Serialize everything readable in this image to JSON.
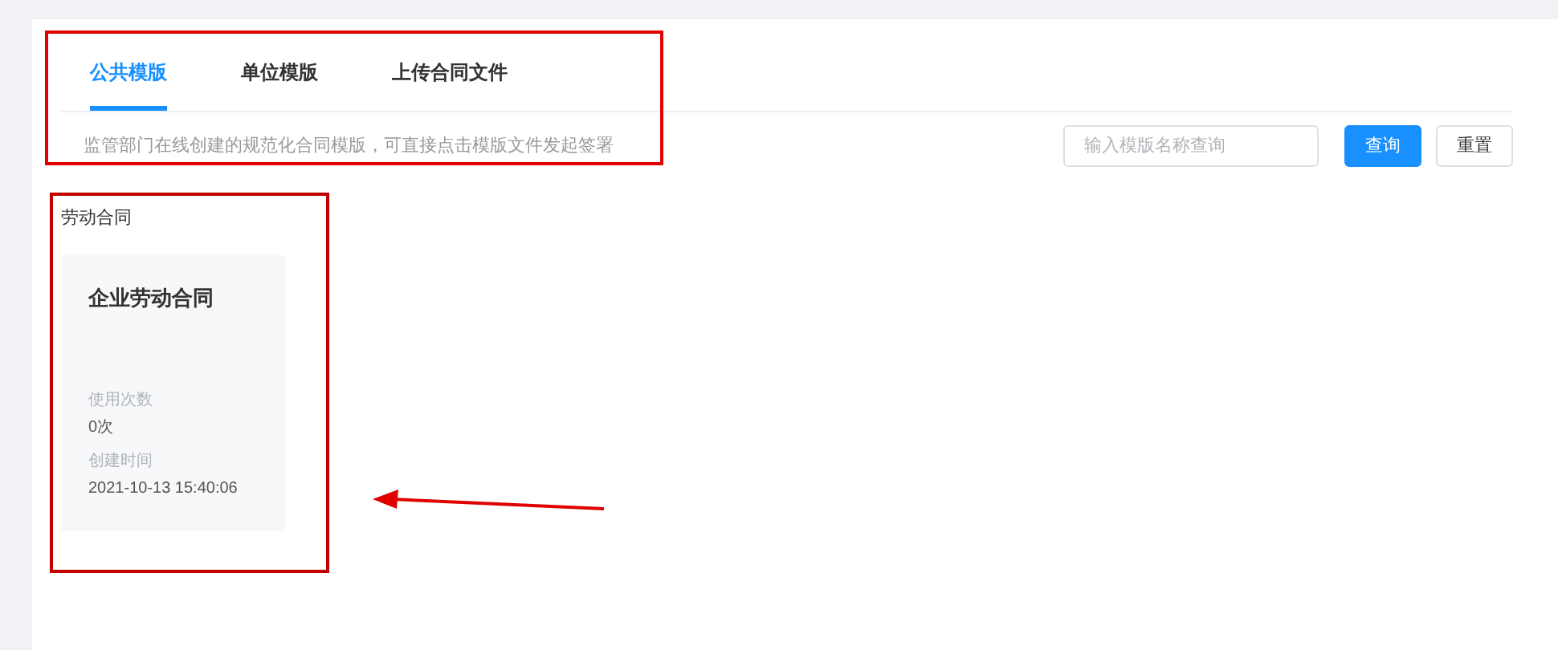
{
  "tabs": [
    {
      "label": "公共模版",
      "selected": true
    },
    {
      "label": "单位模版",
      "selected": false
    },
    {
      "label": "上传合同文件",
      "selected": false
    }
  ],
  "description": "监管部门在线创建的规范化合同模版，可直接点击模版文件发起签署",
  "search": {
    "placeholder": "输入模版名称查询"
  },
  "buttons": [
    {
      "label": "查询",
      "kind": "primary"
    },
    {
      "label": "重置",
      "kind": "default"
    }
  ],
  "section": {
    "title": "劳动合同",
    "cards": [
      {
        "title": "企业劳动合同",
        "fields": [
          {
            "label": "使用次数",
            "value": "0次"
          },
          {
            "label": "创建时间",
            "value": "2021-10-13 15:40:06"
          }
        ]
      }
    ]
  }
}
